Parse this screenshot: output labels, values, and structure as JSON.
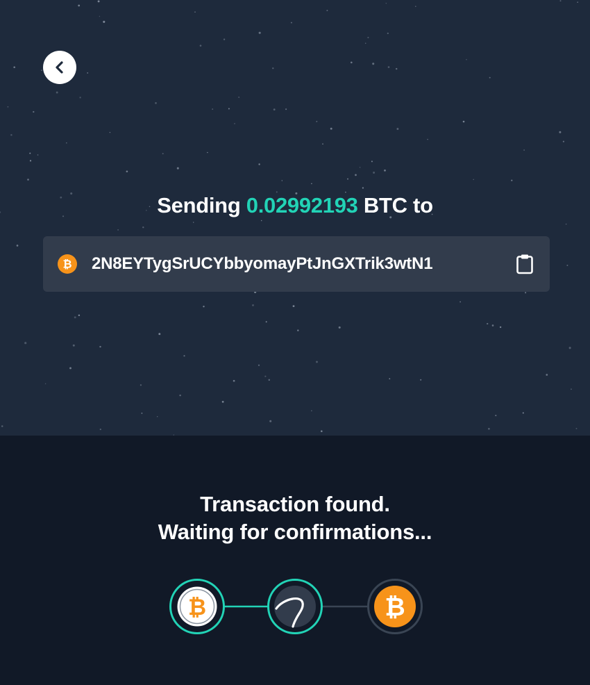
{
  "header": {
    "back_icon": "chevron-left-icon"
  },
  "sending": {
    "prefix": "Sending",
    "amount": "0.02992193",
    "currency": "BTC",
    "suffix": "to"
  },
  "address": {
    "coin_icon": "bitcoin-icon",
    "value": "2N8EYTygSrUCYbbyomayPtJnGXTrik3wtN1",
    "copy_icon": "clipboard-icon"
  },
  "status": {
    "line1": "Transaction found.",
    "line2": "Waiting for confirmations..."
  },
  "progress": {
    "steps": [
      {
        "icon": "bitcoin-icon",
        "state": "done"
      },
      {
        "icon": "swap-icon",
        "state": "active"
      },
      {
        "icon": "bitcoin-icon",
        "state": "pending"
      }
    ]
  },
  "colors": {
    "accent": "#22d3b6",
    "bitcoin": "#f7931a",
    "top_background": "#1e2a3c",
    "bottom_background": "#111927",
    "address_box": "#323c4c"
  }
}
